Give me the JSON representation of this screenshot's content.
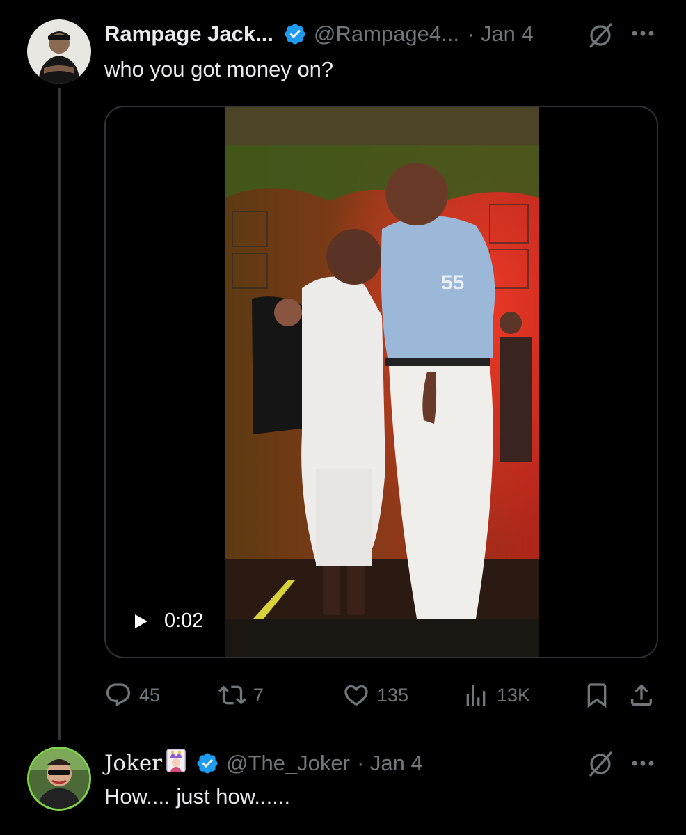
{
  "tweets": [
    {
      "display_name": "Rampage Jack...",
      "handle": "@Rampage4...",
      "date": "· Jan 4",
      "text": "who you got money on?",
      "video": {
        "duration": "0:02"
      },
      "stats": {
        "replies": "45",
        "reposts": "7",
        "likes": "135",
        "views": "13K"
      }
    },
    {
      "display_name": "Joker",
      "handle": "@The_Joker",
      "date": "· Jan 4",
      "text": "How.... just how......"
    }
  ],
  "colors": {
    "background": "#000000",
    "text": "#e7e9ea",
    "muted": "#71767b",
    "verified": "#1d9bf0",
    "border": "#2f3336"
  },
  "icons": [
    "verified-badge-icon",
    "grok-icon",
    "more-icon",
    "play-icon",
    "reply-icon",
    "repost-icon",
    "like-icon",
    "views-icon",
    "bookmark-icon",
    "share-icon",
    "jester-emoji-icon"
  ]
}
